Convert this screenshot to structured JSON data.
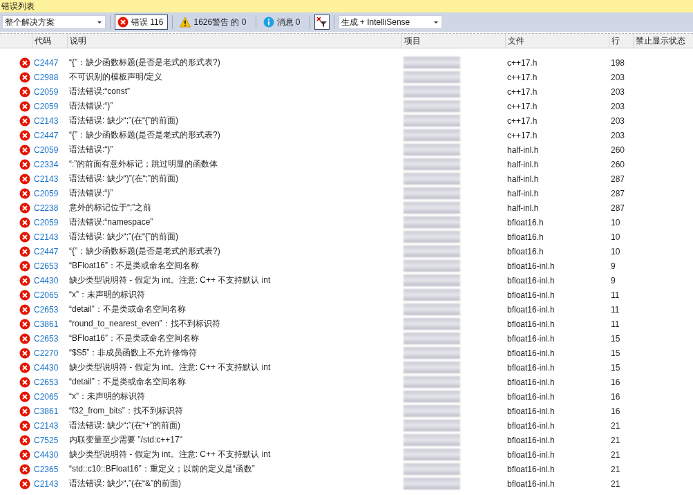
{
  "window": {
    "title": "错误列表"
  },
  "toolbar": {
    "scope": "整个解决方案",
    "filters": [
      {
        "kind": "error",
        "label": "错误 116",
        "selected": true
      },
      {
        "kind": "warning",
        "label": "1626警告 的 0",
        "selected": false
      },
      {
        "kind": "info",
        "label": "消息 0",
        "selected": false
      }
    ],
    "filter_toggle": {
      "on": true
    },
    "source": "生成 + IntelliSense"
  },
  "table": {
    "columns": [
      "代码",
      "说明",
      "项目",
      "文件",
      "行",
      "禁止显示状态"
    ],
    "rows": [
      {
        "kind": "error",
        "code": "C2447",
        "description": "“{”：缺少函数标题(是否是老式的形式表?)",
        "file": "c++17.h",
        "line": "198"
      },
      {
        "kind": "error",
        "code": "C2988",
        "description": "不可识别的模板声明/定义",
        "file": "c++17.h",
        "line": "203"
      },
      {
        "kind": "error",
        "code": "C2059",
        "description": "语法错误:“const”",
        "file": "c++17.h",
        "line": "203"
      },
      {
        "kind": "error",
        "code": "C2059",
        "description": "语法错误:“)”",
        "file": "c++17.h",
        "line": "203"
      },
      {
        "kind": "error",
        "code": "C2143",
        "description": "语法错误: 缺少“;”(在“{”的前面)",
        "file": "c++17.h",
        "line": "203"
      },
      {
        "kind": "error",
        "code": "C2447",
        "description": "“{”：缺少函数标题(是否是老式的形式表?)",
        "file": "c++17.h",
        "line": "203"
      },
      {
        "kind": "error",
        "code": "C2059",
        "description": "语法错误:“)”",
        "file": "half-inl.h",
        "line": "260"
      },
      {
        "kind": "error",
        "code": "C2334",
        "description": "“:”的前面有意外标记；跳过明显的函数体",
        "file": "half-inl.h",
        "line": "260"
      },
      {
        "kind": "error",
        "code": "C2143",
        "description": "语法错误: 缺少“)”(在“;”的前面)",
        "file": "half-inl.h",
        "line": "287"
      },
      {
        "kind": "error",
        "code": "C2059",
        "description": "语法错误:“)”",
        "file": "half-inl.h",
        "line": "287"
      },
      {
        "kind": "error",
        "code": "C2238",
        "description": "意外的标记位于“;”之前",
        "file": "half-inl.h",
        "line": "287"
      },
      {
        "kind": "error",
        "code": "C2059",
        "description": "语法错误:“namespace”",
        "file": "bfloat16.h",
        "line": "10"
      },
      {
        "kind": "error",
        "code": "C2143",
        "description": "语法错误: 缺少“;”(在“{”的前面)",
        "file": "bfloat16.h",
        "line": "10"
      },
      {
        "kind": "error",
        "code": "C2447",
        "description": "“{”：缺少函数标题(是否是老式的形式表?)",
        "file": "bfloat16.h",
        "line": "10"
      },
      {
        "kind": "error",
        "code": "C2653",
        "description": "“BFloat16”：不是类或命名空间名称",
        "file": "bfloat16-inl.h",
        "line": "9"
      },
      {
        "kind": "error",
        "code": "C4430",
        "description": "缺少类型说明符 - 假定为 int。注意: C++ 不支持默认 int",
        "file": "bfloat16-inl.h",
        "line": "9"
      },
      {
        "kind": "error",
        "code": "C2065",
        "description": "“x”：未声明的标识符",
        "file": "bfloat16-inl.h",
        "line": "11"
      },
      {
        "kind": "error",
        "code": "C2653",
        "description": "“detail”：不是类或命名空间名称",
        "file": "bfloat16-inl.h",
        "line": "11"
      },
      {
        "kind": "error",
        "code": "C3861",
        "description": "“round_to_nearest_even”：找不到标识符",
        "file": "bfloat16-inl.h",
        "line": "11"
      },
      {
        "kind": "error",
        "code": "C2653",
        "description": "“BFloat16”：不是类或命名空间名称",
        "file": "bfloat16-inl.h",
        "line": "15"
      },
      {
        "kind": "error",
        "code": "C2270",
        "description": "“$S5”：非成员函数上不允许修饰符",
        "file": "bfloat16-inl.h",
        "line": "15"
      },
      {
        "kind": "error",
        "code": "C4430",
        "description": "缺少类型说明符 - 假定为 int。注意: C++ 不支持默认 int",
        "file": "bfloat16-inl.h",
        "line": "15"
      },
      {
        "kind": "error",
        "code": "C2653",
        "description": "“detail”：不是类或命名空间名称",
        "file": "bfloat16-inl.h",
        "line": "16"
      },
      {
        "kind": "error",
        "code": "C2065",
        "description": "“x”：未声明的标识符",
        "file": "bfloat16-inl.h",
        "line": "16"
      },
      {
        "kind": "error",
        "code": "C3861",
        "description": "“f32_from_bits”：找不到标识符",
        "file": "bfloat16-inl.h",
        "line": "16"
      },
      {
        "kind": "error",
        "code": "C2143",
        "description": "语法错误: 缺少“;”(在“+”的前面)",
        "file": "bfloat16-inl.h",
        "line": "21"
      },
      {
        "kind": "error",
        "code": "C7525",
        "description": "内联变量至少需要 \"/std:c++17\"",
        "file": "bfloat16-inl.h",
        "line": "21"
      },
      {
        "kind": "error",
        "code": "C4430",
        "description": "缺少类型说明符 - 假定为 int。注意: C++ 不支持默认 int",
        "file": "bfloat16-inl.h",
        "line": "21"
      },
      {
        "kind": "error",
        "code": "C2365",
        "description": "“std::c10::BFloat16”：重定义；以前的定义是“函数”",
        "file": "bfloat16-inl.h",
        "line": "21"
      },
      {
        "kind": "error",
        "code": "C2143",
        "description": "语法错误: 缺少“,”(在“&”的前面)",
        "file": "bfloat16-inl.h",
        "line": "21"
      }
    ]
  }
}
